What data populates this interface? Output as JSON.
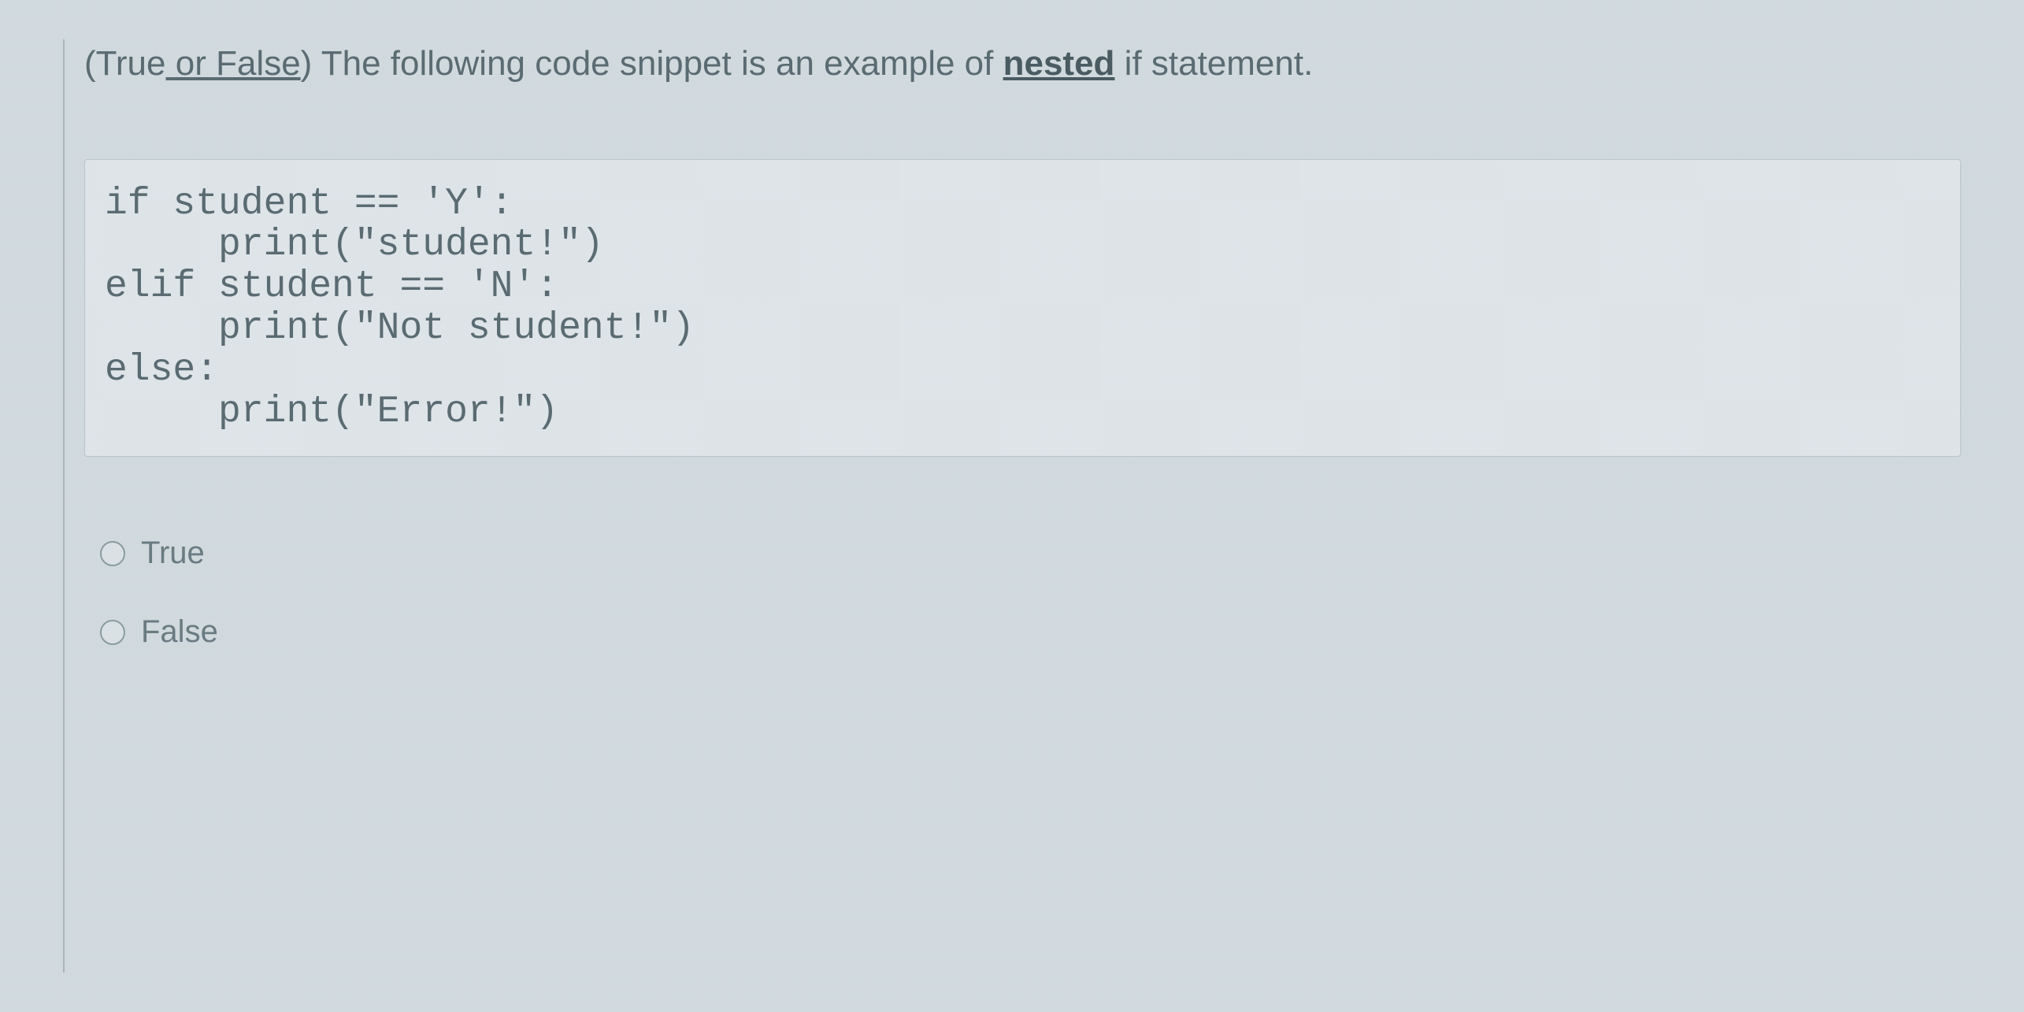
{
  "question": {
    "prefix": "(True",
    "or_false": " or False",
    "closing": ")",
    "main_text": "  The following code snippet is an example of ",
    "emphasis": "nested",
    "suffix": " if statement."
  },
  "code": {
    "line1": "if student == 'Y':",
    "line2": "     print(\"student!\")",
    "line3": "elif student == 'N':",
    "line4": "     print(\"Not student!\")",
    "line5": "else:",
    "line6": "     print(\"Error!\")"
  },
  "options": {
    "opt1": "True",
    "opt2": "False"
  }
}
